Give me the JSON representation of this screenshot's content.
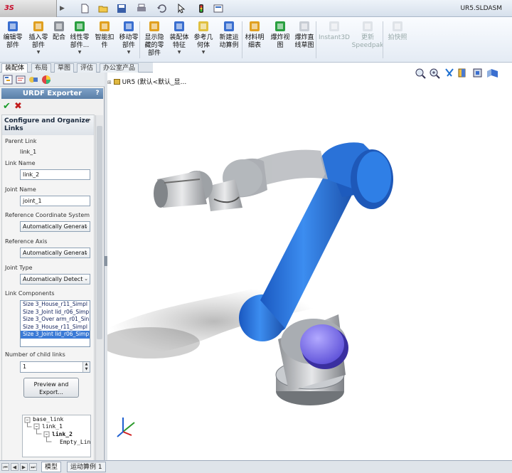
{
  "app": {
    "brand": "3S SOLIDWORKS",
    "document": "UR5.SLDASM"
  },
  "quick_access": [
    "new-icon",
    "open-icon",
    "save-icon",
    "print-icon",
    "undo-icon",
    "select-icon",
    "rebuild-icon",
    "options-icon"
  ],
  "ribbon": [
    {
      "label": "编辑零\n部件",
      "icon": "edit-component-icon",
      "dropdown": false
    },
    {
      "label": "插入零\n部件",
      "icon": "insert-component-icon",
      "dropdown": true
    },
    {
      "label": "配合",
      "icon": "mate-icon",
      "dropdown": false
    },
    {
      "label": "线性零\n部件...",
      "icon": "linear-pattern-icon",
      "dropdown": true
    },
    {
      "label": "智能扣\n件",
      "icon": "smart-fastener-icon",
      "dropdown": false
    },
    {
      "label": "移动零\n部件",
      "icon": "move-component-icon",
      "dropdown": true
    },
    {
      "label": "显示隐\n藏的零\n部件",
      "icon": "show-hidden-icon",
      "dropdown": false
    },
    {
      "label": "装配体\n特征",
      "icon": "assembly-feature-icon",
      "dropdown": true
    },
    {
      "label": "参考几\n何体",
      "icon": "reference-geometry-icon",
      "dropdown": true
    },
    {
      "label": "新建运\n动算例",
      "icon": "new-motion-study-icon",
      "dropdown": false
    },
    {
      "label": "材料明\n细表",
      "icon": "bom-icon",
      "dropdown": false
    },
    {
      "label": "爆炸视\n图",
      "icon": "exploded-view-icon",
      "dropdown": false
    },
    {
      "label": "爆炸直\n线草图",
      "icon": "explode-line-icon",
      "dropdown": false
    },
    {
      "label": "Instant3D",
      "icon": "instant3d-icon",
      "dropdown": false,
      "disabled": true
    },
    {
      "label": "更新\nSpeedpak",
      "icon": "speedpak-icon",
      "dropdown": false,
      "disabled": true
    },
    {
      "label": "拍快照",
      "icon": "snapshot-icon",
      "dropdown": false,
      "disabled": true
    }
  ],
  "tabs": [
    "装配体",
    "布局",
    "草图",
    "评估",
    "办公室产品"
  ],
  "panel": {
    "title": "URDF Exporter",
    "help": "?",
    "group_title": "Configure and Organize Links",
    "parent_link_label": "Parent Link",
    "parent_link_value": "link_1",
    "link_name_label": "Link Name",
    "link_name_value": "link_2",
    "joint_name_label": "Joint Name",
    "joint_name_value": "joint_1",
    "ref_coord_label": "Reference Coordinate System",
    "ref_coord_value": "Automatically Generat",
    "ref_axis_label": "Reference Axis",
    "ref_axis_value": "Automatically Generat",
    "joint_type_label": "Joint Type",
    "joint_type_value": "Automatically Detect",
    "link_components_label": "Link Components",
    "link_components": [
      {
        "text": "Size 3_House_r11_Simpl",
        "selected": false
      },
      {
        "text": "Size 3_Joint lid_r06_Simp",
        "selected": false
      },
      {
        "text": "Size 3_Over arm_r01_Sin",
        "selected": false
      },
      {
        "text": "Size 3_House_r11_Simpl",
        "selected": false
      },
      {
        "text": "Size 3_Joint lid_r06_Simp",
        "selected": true
      }
    ],
    "child_links_label": "Number of child links",
    "child_links_value": "1",
    "preview_button": "Preview and\nExport...",
    "tree": [
      "base_link",
      "link_1",
      "link_2",
      "Empty_Lin"
    ]
  },
  "viewport": {
    "tree_root": "UR5  (默认<默认_显..."
  },
  "bottom_tabs": [
    "模型",
    "运动算例 1"
  ],
  "colors": {
    "accent_blue": "#2f7fe0",
    "cap_purple": "#7b6fe6",
    "header": "#5a7fa8"
  }
}
